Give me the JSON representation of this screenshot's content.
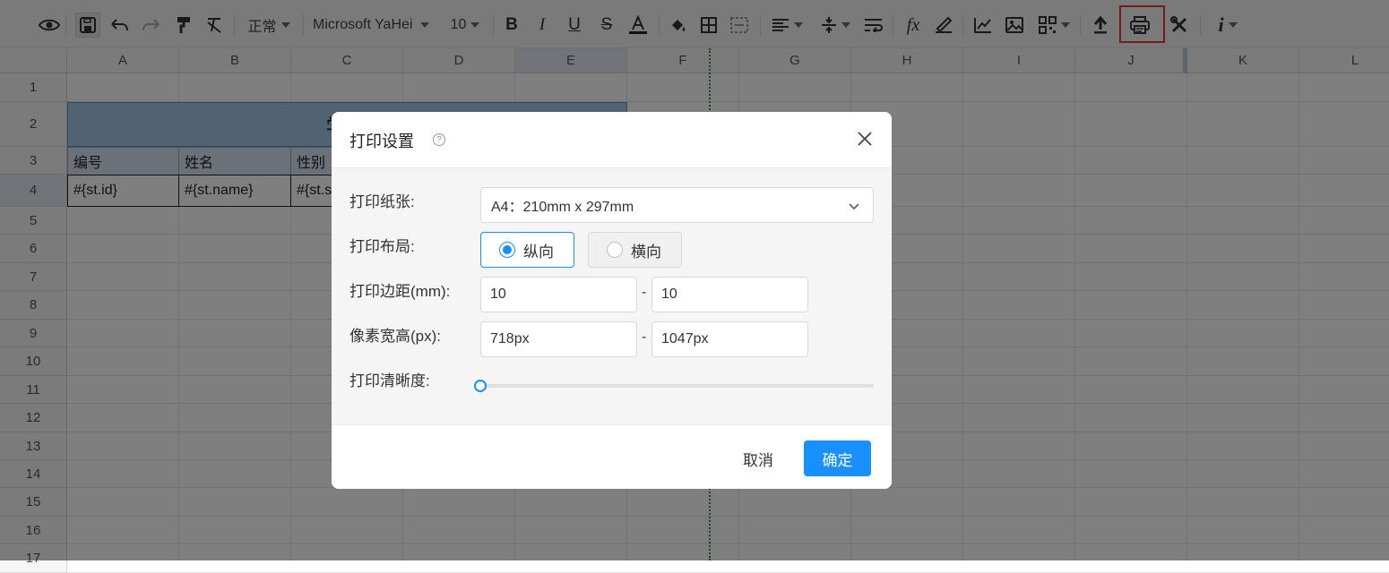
{
  "toolbar": {
    "style_select": "正常",
    "font_select": "Microsoft YaHei",
    "size_select": "10",
    "icons": [
      "preview-icon",
      "save-icon",
      "undo-icon",
      "redo-icon",
      "format-painter-icon",
      "clear-format-icon",
      "bold-icon",
      "italic-icon",
      "underline-icon",
      "strikethrough-icon",
      "font-color-icon",
      "fill-color-icon",
      "border-icon",
      "merge-cells-icon",
      "align-icon",
      "valign-icon",
      "wrap-icon",
      "formula-icon",
      "sign-icon",
      "chart-icon",
      "image-icon",
      "qrcode-icon",
      "upload-icon",
      "print-icon",
      "tools-icon",
      "info-icon"
    ],
    "highlight_color": "#e03c31"
  },
  "sheet": {
    "columns": [
      "A",
      "B",
      "C",
      "D",
      "E",
      "F",
      "G",
      "H",
      "I",
      "J",
      "K",
      "L"
    ],
    "rows": [
      "1",
      "2",
      "3",
      "4",
      "5",
      "6",
      "7",
      "8",
      "9",
      "10",
      "11",
      "12",
      "13",
      "14",
      "15",
      "16",
      "17"
    ],
    "title_cell": "学生",
    "header_cells": [
      "编号",
      "姓名",
      "性别"
    ],
    "data_cells": [
      "#{st.id}",
      "#{st.name}",
      "#{st.s"
    ],
    "title_fill": "#a3c5e6",
    "header_fill": "#d5e3f1"
  },
  "dialog": {
    "title": "打印设置",
    "help_icon": "?",
    "paper_label": "打印纸张:",
    "paper_value": "A4：210mm x 297mm",
    "layout_label": "打印布局:",
    "layout_options": [
      "纵向",
      "横向"
    ],
    "layout_selected": "纵向",
    "margin_label": "打印边距(mm):",
    "margin_values": [
      "10",
      "10"
    ],
    "pixel_label": "像素宽高(px):",
    "pixel_values": [
      "718px",
      "1047px"
    ],
    "separator": "-",
    "clarity_label": "打印清晰度:",
    "clarity_value": 0,
    "cancel_label": "取消",
    "ok_label": "确定",
    "accent_color": "#1890ff"
  }
}
